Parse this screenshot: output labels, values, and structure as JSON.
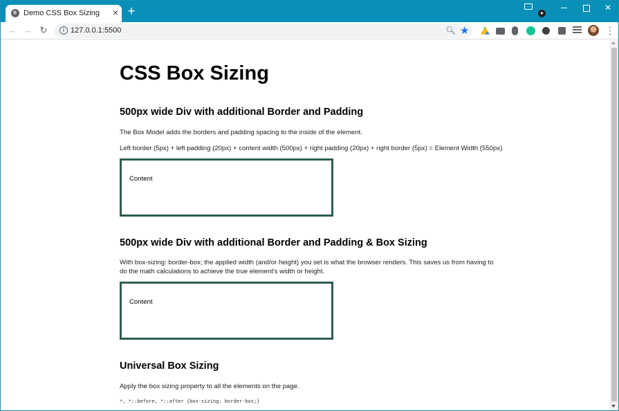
{
  "browser": {
    "tab_title": "Demo CSS Box Sizing",
    "tab_close": "×",
    "new_tab": "+",
    "url": "127.0.0.1:5500",
    "accent_color": "#0890b8"
  },
  "page": {
    "title": "CSS Box Sizing",
    "section1": {
      "heading": "500px wide Div with additional Border and Padding",
      "para1": "The Box Model adds the borders and padding spacing to the inside of the element.",
      "para2": "Left border (5px) + left padding (20px) + content width (500px) + right padding (20px) + right border (5px) = Element Width (550px)",
      "box_text": "Content"
    },
    "section2": {
      "heading": "500px wide Div with additional Border and Padding & Box Sizing",
      "para1": "With box-sizing: border-box; the applied width (and/or height) you set is what the browser renders. This saves us from having to do the math calculations to achieve the true element's width or height.",
      "box_text": "Content"
    },
    "section3": {
      "heading": "Universal Box Sizing",
      "para1": "Apply the box sizing property to all the elements on the page.",
      "code": "*, *::before, *::after {box-sizing: border-box;}"
    },
    "box_border_color": "#2f5d50"
  }
}
